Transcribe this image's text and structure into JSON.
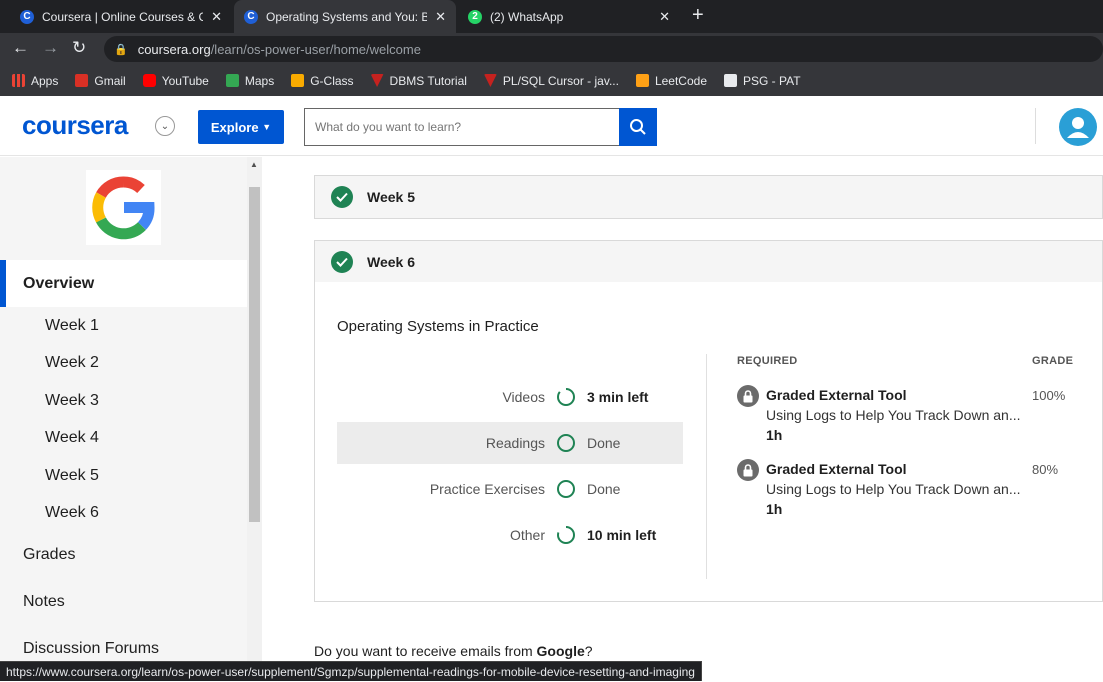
{
  "browser": {
    "tabs": [
      {
        "title": "Coursera | Online Courses & Cre",
        "icon": "coursera-favicon",
        "active": false
      },
      {
        "title": "Operating Systems and You: Bec",
        "icon": "coursera-favicon",
        "active": true
      },
      {
        "title": "(2) WhatsApp",
        "icon": "whatsapp-favicon",
        "active": false
      }
    ],
    "url_host": "coursera.org",
    "url_path": "/learn/os-power-user/home/welcome",
    "bookmarks": [
      {
        "label": "Apps",
        "color": "#ea4335"
      },
      {
        "label": "Gmail",
        "color": "#d93025"
      },
      {
        "label": "YouTube",
        "color": "#ff0000"
      },
      {
        "label": "Maps",
        "color": "#34a853"
      },
      {
        "label": "G-Class",
        "color": "#f9ab00"
      },
      {
        "label": "DBMS Tutorial",
        "color": "#c5221f"
      },
      {
        "label": "PL/SQL Cursor - jav...",
        "color": "#c5221f"
      },
      {
        "label": "LeetCode",
        "color": "#ffa116"
      },
      {
        "label": "PSG - PAT",
        "color": "#e8eaed"
      }
    ],
    "status_url": "https://www.coursera.org/learn/os-power-user/supplement/Sgmzp/supplemental-readings-for-mobile-device-resetting-and-imaging"
  },
  "header": {
    "logo_text": "coursera",
    "explore_label": "Explore",
    "search_placeholder": "What do you want to learn?",
    "brand_color": "#0056d2"
  },
  "sidebar": {
    "overview_label": "Overview",
    "weeks": [
      "Week 1",
      "Week 2",
      "Week 3",
      "Week 4",
      "Week 5",
      "Week 6"
    ],
    "grades_label": "Grades",
    "notes_label": "Notes",
    "forums_label": "Discussion Forums"
  },
  "main": {
    "week5_label": "Week 5",
    "week6_label": "Week 6",
    "module_title": "Operating Systems in Practice",
    "progress": [
      {
        "label": "Videos",
        "status": "3 min left",
        "state": "partial",
        "fraction": 0.85
      },
      {
        "label": "Readings",
        "status": "Done",
        "state": "done",
        "fraction": 1
      },
      {
        "label": "Practice Exercises",
        "status": "Done",
        "state": "done",
        "fraction": 1
      },
      {
        "label": "Other",
        "status": "10 min left",
        "state": "partial",
        "fraction": 0.7
      }
    ],
    "required_header": "REQUIRED",
    "grade_header": "GRADE",
    "graded_items": [
      {
        "title": "Graded External Tool",
        "subtitle": "Using Logs to Help You Track Down an...",
        "duration": "1h",
        "grade": "100%"
      },
      {
        "title": "Graded External Tool",
        "subtitle": "Using Logs to Help You Track Down an...",
        "duration": "1h",
        "grade": "80%"
      }
    ],
    "email_prompt_prefix": "Do you want to receive emails from ",
    "email_prompt_org": "Google",
    "email_prompt_suffix": "?"
  }
}
